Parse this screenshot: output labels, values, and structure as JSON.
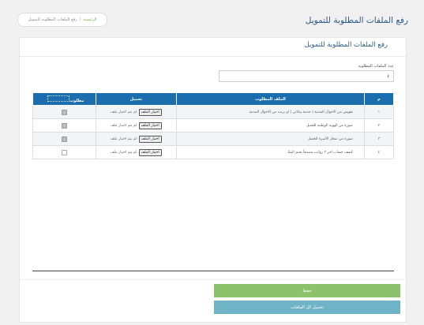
{
  "page": {
    "title": "رفع الملفات المطلوبة للتمويل"
  },
  "breadcrumb": {
    "home": "الرئيسية",
    "current": "رفع الملفات المطلوبة للتمويل"
  },
  "panel": {
    "title": "رفع الملفات المطلوبة للتمويل",
    "count_label": "عدد الملفات المطلوبة",
    "count_value": "٤"
  },
  "table": {
    "headers": {
      "num": "م",
      "name": "الملف المطلوب",
      "upload": "تحميل",
      "required": "مطلوب"
    },
    "rows": [
      {
        "num": "١",
        "name": "تفويض من الاحوال المدنية ( خدمة بياناتي ) او برنت من الاحوال المدنية",
        "button": "اختيار الملف",
        "status": "لم يتم اختيار ملف",
        "required": true
      },
      {
        "num": "٢",
        "name": "صورة من الهوية الوطنية للعميل",
        "button": "اختيار الملف",
        "status": "لم يتم اختيار ملف",
        "required": true
      },
      {
        "num": "٣",
        "name": "صورة من سجل الأسرة للعميل",
        "button": "اختيار الملف",
        "status": "لم يتم اختيار ملف",
        "required": true
      },
      {
        "num": "٤",
        "name": "كشف حساب اخر ٣ رواتب مصدقاً بختم البنك",
        "button": "اختيار الملف",
        "status": "لم يتم اختيار ملف",
        "required": false
      }
    ]
  },
  "actions": {
    "save": "حفظ",
    "upload_all": "تحميل كل الملفات"
  },
  "colors": {
    "header_blue": "#1b6dad",
    "title_blue": "#2a5a8a",
    "save_green": "#8cc26b",
    "upload_teal": "#6fb3c6"
  }
}
